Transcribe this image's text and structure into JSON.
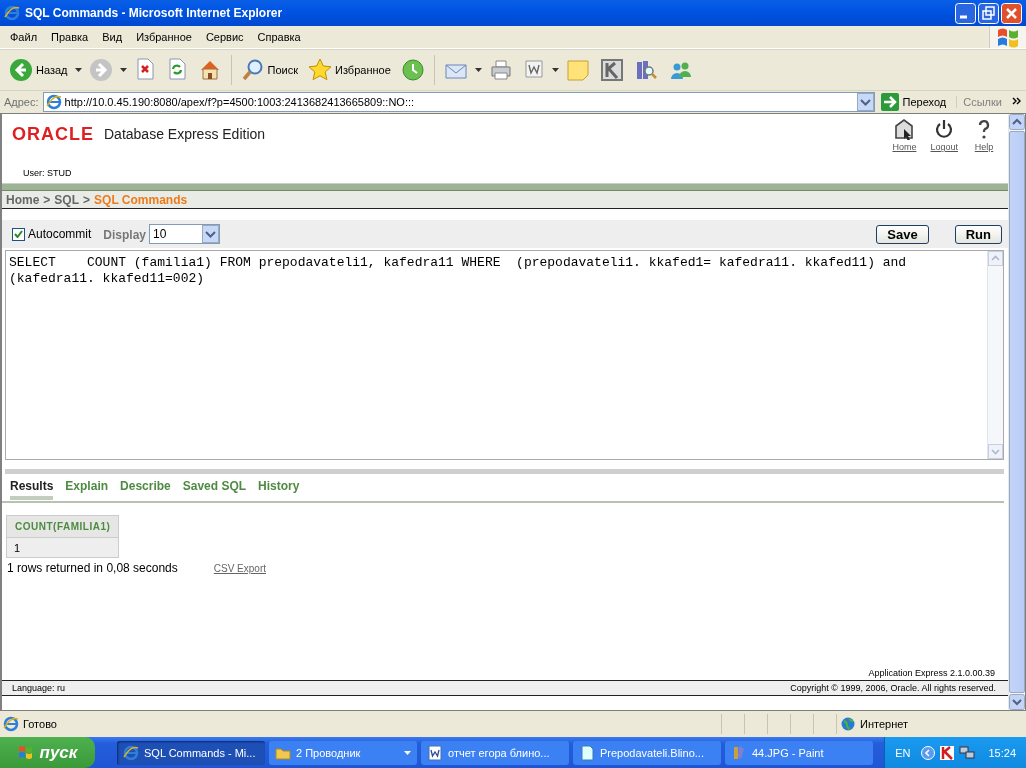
{
  "window": {
    "title": "SQL Commands - Microsoft Internet Explorer"
  },
  "menu": [
    "Файл",
    "Правка",
    "Вид",
    "Избранное",
    "Сервис",
    "Справка"
  ],
  "toolbar": [
    {
      "kind": "back",
      "label": "Назад"
    },
    {
      "kind": "forward"
    },
    {
      "kind": "stop"
    },
    {
      "kind": "refresh"
    },
    {
      "kind": "home"
    },
    {
      "kind": "search",
      "label": "Поиск"
    },
    {
      "kind": "favorites",
      "label": "Избранное"
    },
    {
      "kind": "history"
    },
    {
      "kind": "mail"
    },
    {
      "kind": "print"
    },
    {
      "kind": "edit"
    },
    {
      "kind": "note"
    },
    {
      "kind": "kaspersky"
    },
    {
      "kind": "research"
    },
    {
      "kind": "messenger"
    }
  ],
  "address": {
    "label": "Адрес:",
    "url": "http://10.0.45.190:8080/apex/f?p=4500:1003:2413682413665809::NO:::",
    "go": "Переход",
    "links": "Ссылки"
  },
  "page": {
    "brand": "ORACLE",
    "product": "Database Express Edition",
    "user": "User: STUD",
    "nav": [
      {
        "kind": "home",
        "label": "Home"
      },
      {
        "kind": "logout",
        "label": "Logout"
      },
      {
        "kind": "help",
        "label": "Help"
      }
    ],
    "breadcrumb": [
      {
        "label": "Home",
        "current": false
      },
      {
        "label": "SQL",
        "current": false
      },
      {
        "label": "SQL Commands",
        "current": true
      }
    ],
    "breadcrumb_separator": ">",
    "autocommit": {
      "label": "Autocommit",
      "checked": true
    },
    "display": {
      "label": "Display",
      "value": "10"
    },
    "buttons": [
      "Save",
      "Run"
    ],
    "sql": "SELECT    COUNT (familia1) FROM prepodavateli1, kafedra11 WHERE  (prepodavateli1. kkafed1= kafedra11. kkafed11) and (kafedra11. kkafed11=002)",
    "tabs": [
      {
        "label": "Results",
        "selected": true
      },
      {
        "label": "Explain",
        "selected": false
      },
      {
        "label": "Describe",
        "selected": false
      },
      {
        "label": "Saved SQL",
        "selected": false
      },
      {
        "label": "History",
        "selected": false
      }
    ],
    "results": {
      "columns": [
        "COUNT(FAMILIA1)"
      ],
      "rows": [
        [
          "1"
        ]
      ]
    },
    "summary": "1 rows returned in 0,08 seconds",
    "csv_export": "CSV Export",
    "version": "Application Express 2.1.0.00.39",
    "language": "Language: ru",
    "copyright": "Copyright © 1999, 2006, Oracle. All rights reserved."
  },
  "status_bar": {
    "text": "Готово",
    "zone": "Интернет"
  },
  "taskbar": {
    "start": "пуск",
    "tasks": [
      {
        "kind": "ie",
        "label": "SQL Commands - Mi...",
        "selected": true
      },
      {
        "kind": "folder",
        "label": "2 Проводник",
        "selected": false
      },
      {
        "kind": "word",
        "label": "отчет егора блино...",
        "selected": false
      },
      {
        "kind": "doc",
        "label": "Prepodavateli.Blino...",
        "selected": false
      },
      {
        "kind": "paint",
        "label": "44.JPG - Paint",
        "selected": false
      }
    ],
    "language": "EN",
    "clock": "15:24"
  }
}
